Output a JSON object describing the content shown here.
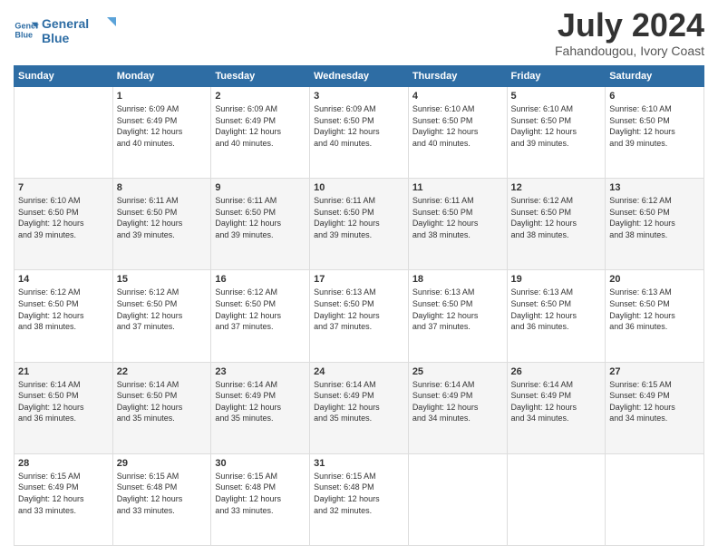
{
  "header": {
    "logo_line1": "General",
    "logo_line2": "Blue",
    "month_year": "July 2024",
    "location": "Fahandougou, Ivory Coast"
  },
  "days_of_week": [
    "Sunday",
    "Monday",
    "Tuesday",
    "Wednesday",
    "Thursday",
    "Friday",
    "Saturday"
  ],
  "weeks": [
    [
      {
        "day": "",
        "info": ""
      },
      {
        "day": "1",
        "info": "Sunrise: 6:09 AM\nSunset: 6:49 PM\nDaylight: 12 hours\nand 40 minutes."
      },
      {
        "day": "2",
        "info": "Sunrise: 6:09 AM\nSunset: 6:49 PM\nDaylight: 12 hours\nand 40 minutes."
      },
      {
        "day": "3",
        "info": "Sunrise: 6:09 AM\nSunset: 6:50 PM\nDaylight: 12 hours\nand 40 minutes."
      },
      {
        "day": "4",
        "info": "Sunrise: 6:10 AM\nSunset: 6:50 PM\nDaylight: 12 hours\nand 40 minutes."
      },
      {
        "day": "5",
        "info": "Sunrise: 6:10 AM\nSunset: 6:50 PM\nDaylight: 12 hours\nand 39 minutes."
      },
      {
        "day": "6",
        "info": "Sunrise: 6:10 AM\nSunset: 6:50 PM\nDaylight: 12 hours\nand 39 minutes."
      }
    ],
    [
      {
        "day": "7",
        "info": "Sunrise: 6:10 AM\nSunset: 6:50 PM\nDaylight: 12 hours\nand 39 minutes."
      },
      {
        "day": "8",
        "info": "Sunrise: 6:11 AM\nSunset: 6:50 PM\nDaylight: 12 hours\nand 39 minutes."
      },
      {
        "day": "9",
        "info": "Sunrise: 6:11 AM\nSunset: 6:50 PM\nDaylight: 12 hours\nand 39 minutes."
      },
      {
        "day": "10",
        "info": "Sunrise: 6:11 AM\nSunset: 6:50 PM\nDaylight: 12 hours\nand 39 minutes."
      },
      {
        "day": "11",
        "info": "Sunrise: 6:11 AM\nSunset: 6:50 PM\nDaylight: 12 hours\nand 38 minutes."
      },
      {
        "day": "12",
        "info": "Sunrise: 6:12 AM\nSunset: 6:50 PM\nDaylight: 12 hours\nand 38 minutes."
      },
      {
        "day": "13",
        "info": "Sunrise: 6:12 AM\nSunset: 6:50 PM\nDaylight: 12 hours\nand 38 minutes."
      }
    ],
    [
      {
        "day": "14",
        "info": "Sunrise: 6:12 AM\nSunset: 6:50 PM\nDaylight: 12 hours\nand 38 minutes."
      },
      {
        "day": "15",
        "info": "Sunrise: 6:12 AM\nSunset: 6:50 PM\nDaylight: 12 hours\nand 37 minutes."
      },
      {
        "day": "16",
        "info": "Sunrise: 6:12 AM\nSunset: 6:50 PM\nDaylight: 12 hours\nand 37 minutes."
      },
      {
        "day": "17",
        "info": "Sunrise: 6:13 AM\nSunset: 6:50 PM\nDaylight: 12 hours\nand 37 minutes."
      },
      {
        "day": "18",
        "info": "Sunrise: 6:13 AM\nSunset: 6:50 PM\nDaylight: 12 hours\nand 37 minutes."
      },
      {
        "day": "19",
        "info": "Sunrise: 6:13 AM\nSunset: 6:50 PM\nDaylight: 12 hours\nand 36 minutes."
      },
      {
        "day": "20",
        "info": "Sunrise: 6:13 AM\nSunset: 6:50 PM\nDaylight: 12 hours\nand 36 minutes."
      }
    ],
    [
      {
        "day": "21",
        "info": "Sunrise: 6:14 AM\nSunset: 6:50 PM\nDaylight: 12 hours\nand 36 minutes."
      },
      {
        "day": "22",
        "info": "Sunrise: 6:14 AM\nSunset: 6:50 PM\nDaylight: 12 hours\nand 35 minutes."
      },
      {
        "day": "23",
        "info": "Sunrise: 6:14 AM\nSunset: 6:49 PM\nDaylight: 12 hours\nand 35 minutes."
      },
      {
        "day": "24",
        "info": "Sunrise: 6:14 AM\nSunset: 6:49 PM\nDaylight: 12 hours\nand 35 minutes."
      },
      {
        "day": "25",
        "info": "Sunrise: 6:14 AM\nSunset: 6:49 PM\nDaylight: 12 hours\nand 34 minutes."
      },
      {
        "day": "26",
        "info": "Sunrise: 6:14 AM\nSunset: 6:49 PM\nDaylight: 12 hours\nand 34 minutes."
      },
      {
        "day": "27",
        "info": "Sunrise: 6:15 AM\nSunset: 6:49 PM\nDaylight: 12 hours\nand 34 minutes."
      }
    ],
    [
      {
        "day": "28",
        "info": "Sunrise: 6:15 AM\nSunset: 6:49 PM\nDaylight: 12 hours\nand 33 minutes."
      },
      {
        "day": "29",
        "info": "Sunrise: 6:15 AM\nSunset: 6:48 PM\nDaylight: 12 hours\nand 33 minutes."
      },
      {
        "day": "30",
        "info": "Sunrise: 6:15 AM\nSunset: 6:48 PM\nDaylight: 12 hours\nand 33 minutes."
      },
      {
        "day": "31",
        "info": "Sunrise: 6:15 AM\nSunset: 6:48 PM\nDaylight: 12 hours\nand 32 minutes."
      },
      {
        "day": "",
        "info": ""
      },
      {
        "day": "",
        "info": ""
      },
      {
        "day": "",
        "info": ""
      }
    ]
  ]
}
